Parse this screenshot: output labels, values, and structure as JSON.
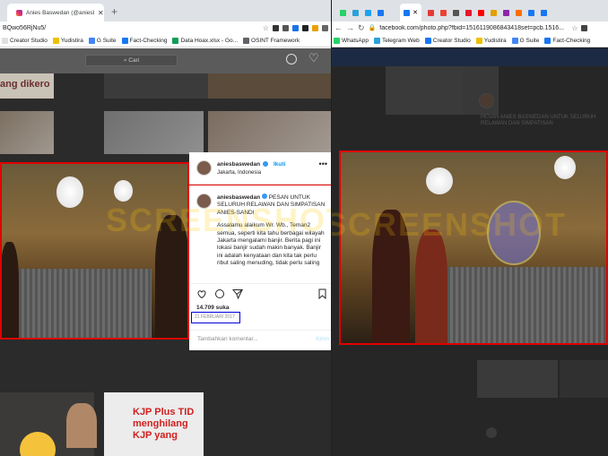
{
  "left_window": {
    "tab_title": "Anies Baswedan (@aniesbaswedan)",
    "url": "BQwo56RjNu5/",
    "bookmarks": [
      {
        "label": "Creator Studio",
        "color": "#e0e0e0"
      },
      {
        "label": "Yudistira",
        "color": "#f0c000"
      },
      {
        "label": "G Suite",
        "color": "#4285f4"
      },
      {
        "label": "Fact-Checking",
        "color": "#1877f2"
      },
      {
        "label": "Data Hoax.xlsx - Go...",
        "color": "#0f9d58"
      },
      {
        "label": "OSINT Framework",
        "color": "#5f6368"
      }
    ],
    "search_placeholder": "Cari",
    "bg_text_1": "ang dikero",
    "bg_text_2": "KJP Plus TID menghilang KJP yang",
    "post": {
      "username": "aniesbaswedan",
      "follow_label": "Ikuti",
      "location": "Jakarta, Indonesia",
      "caption_user": "aniesbaswedan",
      "caption_title": "PESAN UNTUK SELURUH RELAWAN DAN SIMPATISAN ANIES-SANDI",
      "caption_body": "Assalamu alaikum Wr. Wb., Teman2 semua, seperti kita tahu berbagai wilayah Jakarta mengalami banjir. Berita pagi ini lokasi banjir sudah makin banyak. Banjir ini adalah kenyataan dan kita tak perlu ribut saling menuding, tidak perlu saling",
      "likes": "14.709 suka",
      "date": "21 FEBRUARI 2017",
      "comment_placeholder": "Tambahkan komentar...",
      "send_label": "Kirim"
    }
  },
  "right_window": {
    "url": "facebook.com/photo.php?fbid=1516119086843418set=pcb.1516...",
    "bookmarks": [
      {
        "label": "WhatsApp",
        "color": "#25d366"
      },
      {
        "label": "Telegram Web",
        "color": "#2aa1da"
      },
      {
        "label": "Creator Studio",
        "color": "#1877f2"
      },
      {
        "label": "Yudistira",
        "color": "#f0c000"
      },
      {
        "label": "G Suite",
        "color": "#4285f4"
      },
      {
        "label": "Fact-Checking",
        "color": "#1877f2"
      }
    ],
    "bg_text": "PESAN ANIES BASWEDAN UNTUK SELURUH RELAWAN DAN SIMPATISAN"
  },
  "watermark": "SCREENSHOT",
  "colors": {
    "highlight_red": "#e00000",
    "highlight_blue": "#0000d8",
    "ig_blue": "#0095f6"
  }
}
